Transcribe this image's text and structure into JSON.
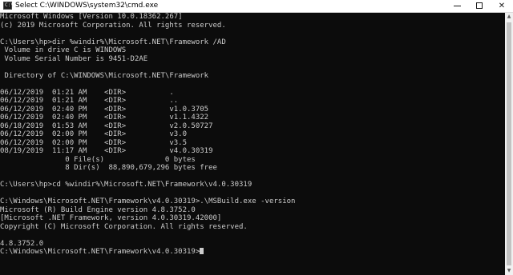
{
  "window": {
    "title": "Select C:\\WINDOWS\\system32\\cmd.exe",
    "icon_label": "C:\\",
    "controls": {
      "minimize": "minimize-icon",
      "maximize": "maximize-icon",
      "close": "✕"
    },
    "background": "#0c0c0c",
    "text_color": "#cccccc"
  },
  "console": {
    "lines": [
      "Microsoft Windows [Version 10.0.18362.267]",
      "(c) 2019 Microsoft Corporation. All rights reserved.",
      "",
      "C:\\Users\\hp>dir %windir%\\Microsoft.NET\\Framework /AD",
      " Volume in drive C is WINDOWS",
      " Volume Serial Number is 9451-D2AE",
      "",
      " Directory of C:\\WINDOWS\\Microsoft.NET\\Framework",
      "",
      "06/12/2019  01:21 AM    <DIR>          .",
      "06/12/2019  01:21 AM    <DIR>          ..",
      "06/12/2019  02:40 PM    <DIR>          v1.0.3705",
      "06/12/2019  02:40 PM    <DIR>          v1.1.4322",
      "06/18/2019  01:53 AM    <DIR>          v2.0.50727",
      "06/12/2019  02:00 PM    <DIR>          v3.0",
      "06/12/2019  02:00 PM    <DIR>          v3.5",
      "08/19/2019  11:17 AM    <DIR>          v4.0.30319",
      "               0 File(s)              0 bytes",
      "               8 Dir(s)  88,890,679,296 bytes free",
      "",
      "C:\\Users\\hp>cd %windir%\\Microsoft.NET\\Framework\\v4.0.30319",
      "",
      "C:\\Windows\\Microsoft.NET\\Framework\\v4.0.30319>.\\MSBuild.exe -version",
      "Microsoft (R) Build Engine version 4.8.3752.0",
      "[Microsoft .NET Framework, version 4.0.30319.42000]",
      "Copyright (C) Microsoft Corporation. All rights reserved.",
      "",
      "4.8.3752.0"
    ],
    "prompt": "C:\\Windows\\Microsoft.NET\\Framework\\v4.0.30319>"
  }
}
